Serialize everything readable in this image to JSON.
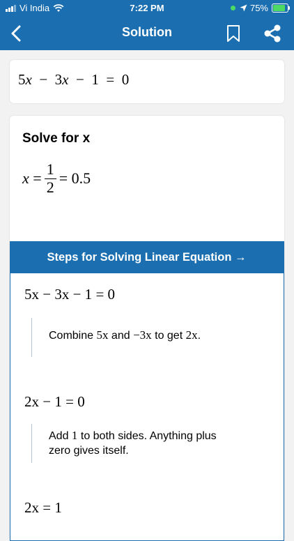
{
  "status_bar": {
    "carrier": "Vi India",
    "time": "7:22 PM",
    "battery": "75%"
  },
  "nav": {
    "title": "Solution"
  },
  "icons": {
    "back": "chevron-left-icon",
    "bookmark": "bookmark-icon",
    "share": "share-icon",
    "wifi": "wifi-icon",
    "location": "location-arrow-icon",
    "battery": "battery-charging-icon"
  },
  "colors": {
    "primary": "#1b6fb0",
    "background": "#f2f2f2",
    "card": "#ffffff"
  },
  "problem": {
    "coef_a": "5",
    "coef_b": "3",
    "const": "1",
    "rhs": "0"
  },
  "result": {
    "heading": "Solve for x",
    "numerator": "1",
    "denominator": "2",
    "decimal": "0.5"
  },
  "steps": {
    "header": "Steps for Solving Linear Equation →",
    "items": [
      {
        "equation_lhs": "5x − 3x − 1",
        "equation_rhs": "0",
        "text_1": "Combine ",
        "math_1": "5x",
        "text_2": " and ",
        "math_2": "−3x",
        "text_3": " to get ",
        "math_3": "2x",
        "text_4": "."
      },
      {
        "equation_lhs": "2x − 1",
        "equation_rhs": "0",
        "text_1": "Add ",
        "math_1": "1",
        "text_2": " to both sides. Anything plus zero gives itself."
      },
      {
        "equation_lhs": "2x",
        "equation_rhs": "1"
      }
    ]
  }
}
